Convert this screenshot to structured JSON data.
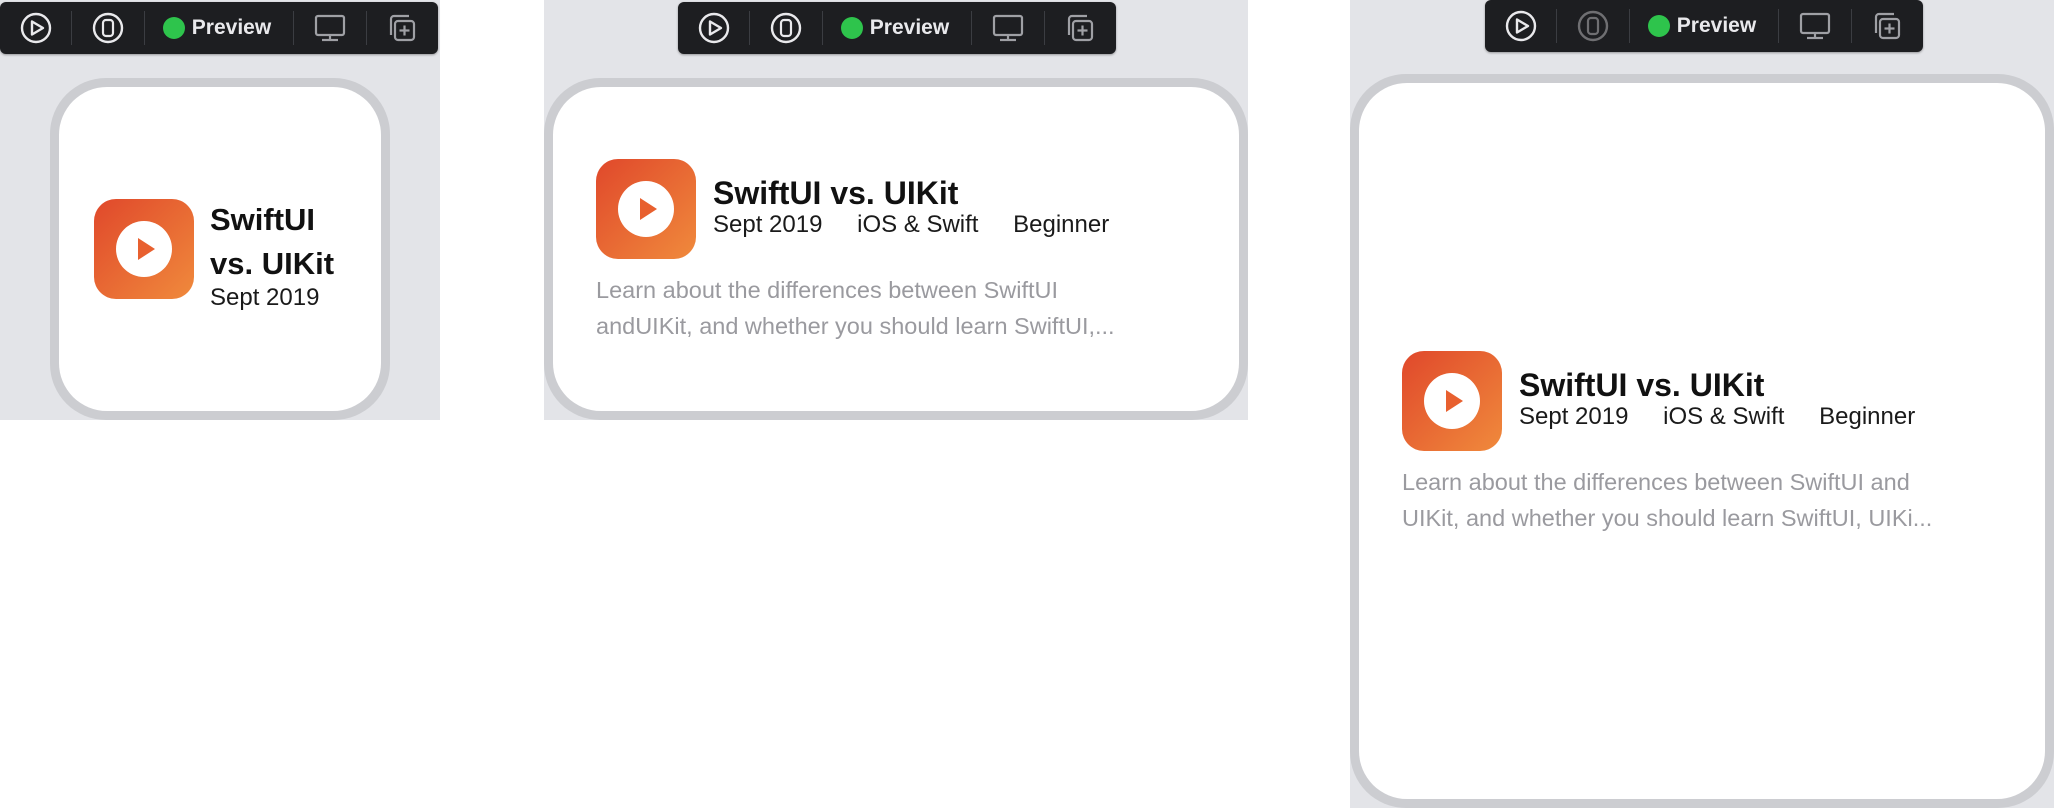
{
  "toolbar": {
    "preview_label": "Preview",
    "icons": [
      "live-preview-icon",
      "device-preview-icon",
      "display-settings-icon",
      "duplicate-preview-icon"
    ],
    "status_color": "#2ec44c"
  },
  "card": {
    "title": "SwiftUI vs. UIKit",
    "title_line1": "SwiftUI",
    "title_line2": "vs. UIKit",
    "date": "Sept 2019",
    "category": "iOS & Swift",
    "level": "Beginner",
    "desc_medium_line1": "Learn about the differences between SwiftUI",
    "desc_medium_line2": "andUIKit, and whether you should learn SwiftUI,...",
    "desc_large_line1": "Learn about the differences between SwiftUI and",
    "desc_large_line2": "UIKit, and whether you should learn SwiftUI, UIKi...",
    "icon": "play-icon",
    "accent_start": "#e0482b",
    "accent_end": "#f08a3c"
  }
}
